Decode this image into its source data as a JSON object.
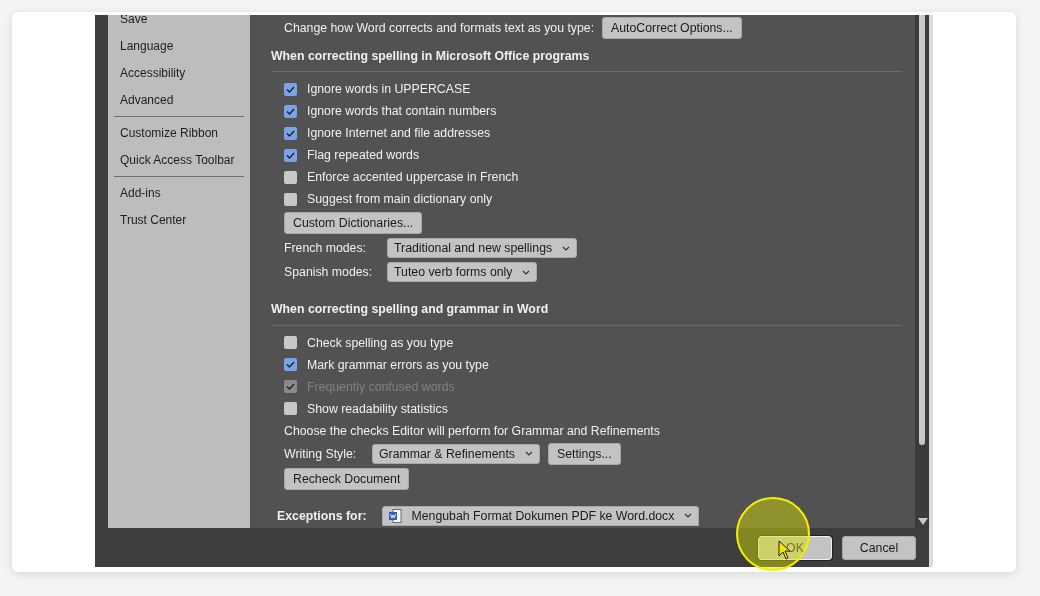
{
  "sidebar": {
    "groups": [
      [
        "Save",
        "Language",
        "Accessibility",
        "Advanced"
      ],
      [
        "Customize Ribbon",
        "Quick Access Toolbar"
      ],
      [
        "Add-ins",
        "Trust Center"
      ]
    ]
  },
  "autocorrect": {
    "label": "Change how Word corrects and formats text as you type:",
    "button": "AutoCorrect Options..."
  },
  "sections": [
    {
      "heading": "When correcting spelling in Microsoft Office programs",
      "items": [
        {
          "kind": "checkbox",
          "label": "Ignore words in UPPERCASE",
          "checked": true,
          "disabled": false
        },
        {
          "kind": "checkbox",
          "label": "Ignore words that contain numbers",
          "checked": true,
          "disabled": false
        },
        {
          "kind": "checkbox",
          "label": "Ignore Internet and file addresses",
          "checked": true,
          "disabled": false
        },
        {
          "kind": "checkbox",
          "label": "Flag repeated words",
          "checked": true,
          "disabled": false
        },
        {
          "kind": "checkbox",
          "label": "Enforce accented uppercase in French",
          "checked": false,
          "disabled": false
        },
        {
          "kind": "checkbox",
          "label": "Suggest from main dictionary only",
          "checked": false,
          "disabled": false
        },
        {
          "kind": "button",
          "label": "Custom Dictionaries..."
        },
        {
          "kind": "select",
          "label": "French modes:",
          "value": "Traditional and new spellings"
        },
        {
          "kind": "select",
          "label": "Spanish modes:",
          "value": "Tuteo verb forms only"
        }
      ]
    },
    {
      "heading": "When correcting spelling and grammar in Word",
      "items": [
        {
          "kind": "checkbox",
          "label": "Check spelling as you type",
          "checked": false,
          "disabled": false
        },
        {
          "kind": "checkbox",
          "label": "Mark grammar errors as you type",
          "checked": true,
          "disabled": false
        },
        {
          "kind": "checkbox",
          "label": "Frequently confused words",
          "checked": true,
          "disabled": true
        },
        {
          "kind": "checkbox",
          "label": "Show readability statistics",
          "checked": false,
          "disabled": false
        },
        {
          "kind": "text",
          "label": "Choose the checks Editor will perform for Grammar and Refinements"
        },
        {
          "kind": "select",
          "label": "Writing Style:",
          "value": "Grammar & Refinements",
          "button": "Settings..."
        },
        {
          "kind": "button",
          "label": "Recheck Document"
        }
      ]
    }
  ],
  "exceptions": {
    "label": "Exceptions for:",
    "value": "Mengubah Format Dokumen PDF ke Word.docx"
  },
  "buttons": [
    {
      "label": "OK",
      "default": true
    },
    {
      "label": "Cancel",
      "default": false
    }
  ]
}
